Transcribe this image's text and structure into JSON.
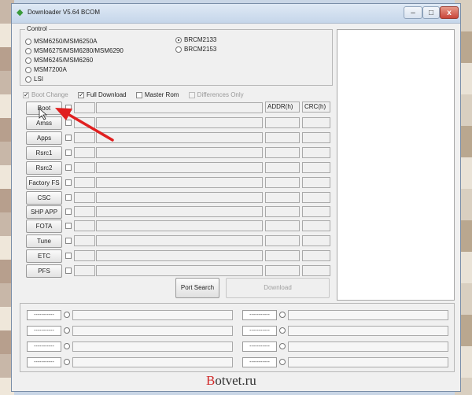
{
  "window": {
    "title": "Downloader V5.64 BCOM"
  },
  "titlebar": {
    "min": "–",
    "max": "□",
    "close": "x"
  },
  "control": {
    "label": "Control",
    "models_left": [
      {
        "label": "MSM6250/MSM6250A",
        "selected": false
      },
      {
        "label": "MSM6275/MSM6280/MSM6290",
        "selected": false
      },
      {
        "label": "MSM6245/MSM6260",
        "selected": false
      },
      {
        "label": "MSM7200A",
        "selected": false
      },
      {
        "label": "LSI",
        "selected": false
      }
    ],
    "models_right": [
      {
        "label": "BRCM2133",
        "selected": true
      },
      {
        "label": "BRCM2153",
        "selected": false
      }
    ]
  },
  "options": {
    "boot_change": "Boot Change",
    "full_download": "Full Download",
    "master_rom": "Master Rom",
    "differences_only": "Differences Only"
  },
  "columns": {
    "addr": "ADDR(h)",
    "crc": "CRC(h)"
  },
  "image_buttons": [
    "Boot",
    "Amss",
    "Apps",
    "Rsrc1",
    "Rsrc2",
    "Factory FS",
    "CSC",
    "SHP APP",
    "FOTA",
    "Tune",
    "ETC",
    "PFS"
  ],
  "actions": {
    "port_search": "Port Search",
    "download": "Download"
  },
  "ports": {
    "left": [
      "-----------",
      "-----------",
      "-----------",
      "-----------"
    ],
    "right": [
      "-----------",
      "-----------",
      "-----------",
      "-----------"
    ]
  },
  "watermark": {
    "first": "B",
    "rest": "otvet.ru"
  },
  "colors": {
    "arrow": "#e02020",
    "window_bg": "#f0f0f0",
    "disabled_text": "#a0a0a0"
  }
}
